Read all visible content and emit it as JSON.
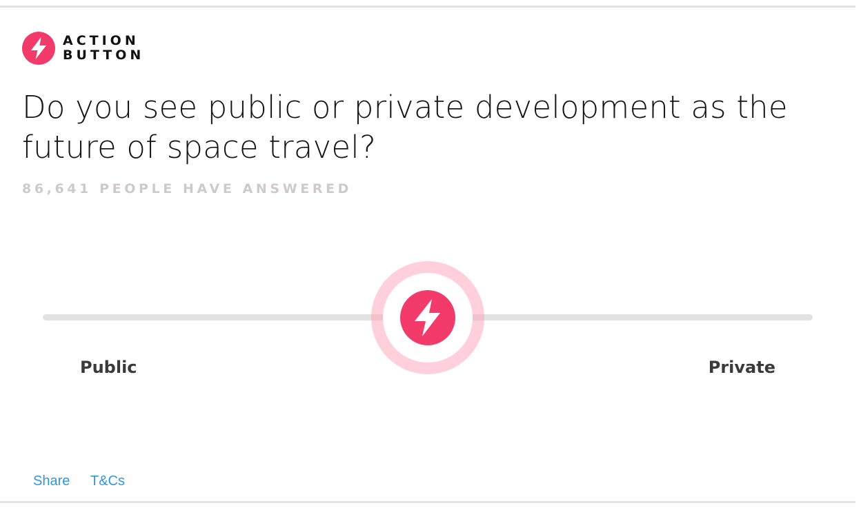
{
  "brand": {
    "line1": "ACTION",
    "line2": "BUTTON",
    "accent_color": "#f23a6b",
    "logo_icon": "lightning-bolt-icon"
  },
  "question": "Do you see public or private development as the future of space travel?",
  "answered_text": "86,641 PEOPLE HAVE ANSWERED",
  "slider": {
    "left_label": "Public",
    "right_label": "Private",
    "value": 0.5,
    "handle_icon": "lightning-bolt-icon"
  },
  "footer": {
    "share_label": "Share",
    "tcs_label": "T&Cs",
    "link_color": "#2f97dc"
  }
}
